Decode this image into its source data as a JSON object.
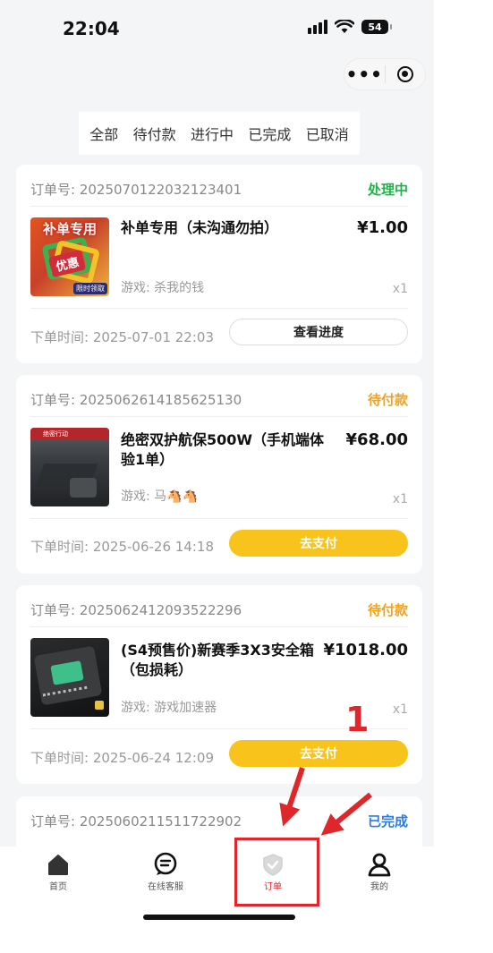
{
  "status_bar": {
    "time": "22:04",
    "battery": "54"
  },
  "capsule": {
    "more_icon": "more-dots-icon",
    "close_icon": "target-icon"
  },
  "tabs": [
    {
      "label": "全部"
    },
    {
      "label": "待付款"
    },
    {
      "label": "进行中"
    },
    {
      "label": "已完成"
    },
    {
      "label": "已取消"
    }
  ],
  "orders": [
    {
      "order_no": "订单号: 2025070122032123401",
      "status": "处理中",
      "status_color": "#1fb24a",
      "title": "补单专用（未沟通勿拍）",
      "price": "¥1.00",
      "game": "游戏: 杀我的钱",
      "qty": "x1",
      "time": "下单时间: 2025-07-01 22:03",
      "action": "查看进度",
      "thumb_text_top": "补单专用",
      "thumb_text_tag": "优惠",
      "thumb_text_bottom": "限时领取"
    },
    {
      "order_no": "订单号: 2025062614185625130",
      "status": "待付款",
      "status_color": "#f0a21e",
      "title": "绝密双护航保500W（手机端体验1单）",
      "price": "¥68.00",
      "game": "游戏: 马🐴🐴",
      "qty": "x1",
      "time": "下单时间: 2025-06-26 14:18",
      "action": "去支付",
      "thumb_text_band": "绝密行动"
    },
    {
      "order_no": "订单号: 2025062412093522296",
      "status": "待付款",
      "status_color": "#f0a21e",
      "title": "(S4预售价)新赛季3X3安全箱（包损耗）",
      "price": "¥1018.00",
      "game": "游戏: 游戏加速器",
      "qty": "x1",
      "time": "下单时间: 2025-06-24 12:09",
      "action": "去支付"
    },
    {
      "order_no": "订单号: 2025060211511722902",
      "status": "已完成",
      "status_color": "#2a7de1"
    }
  ],
  "annotation": {
    "number": "1",
    "color": "#e0262b"
  },
  "bottom_nav": [
    {
      "label": "首页",
      "icon": "home-icon"
    },
    {
      "label": "在线客服",
      "icon": "chat-icon"
    },
    {
      "label": "订单",
      "icon": "order-shield-icon"
    },
    {
      "label": "我的",
      "icon": "user-icon"
    }
  ],
  "colors": {
    "accent_yellow": "#f8c31a",
    "background": "#f4f5f6"
  }
}
